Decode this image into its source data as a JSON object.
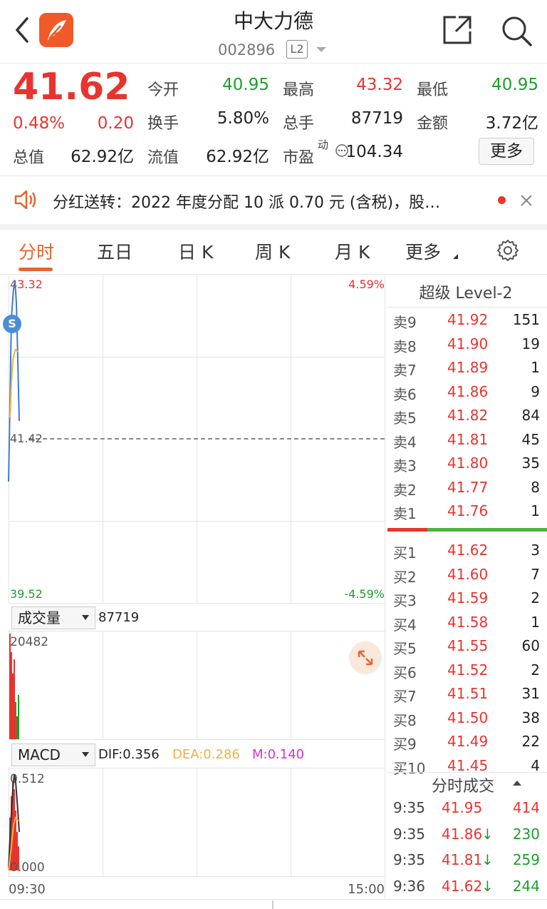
{
  "header": {
    "title": "中大力德",
    "code": "002896",
    "level_badge": "L2"
  },
  "quote": {
    "price": "41.62",
    "change_pct": "0.48%",
    "change": "0.20",
    "fields": [
      {
        "label": "今开",
        "value": "40.95",
        "color": "green"
      },
      {
        "label": "最高",
        "value": "43.32",
        "color": "red"
      },
      {
        "label": "最低",
        "value": "40.95",
        "color": "green"
      },
      {
        "label": "换手",
        "value": "5.80%",
        "color": "black"
      },
      {
        "label": "总手",
        "value": "87719",
        "color": "black"
      },
      {
        "label": "金额",
        "value": "3.72亿",
        "color": "black"
      },
      {
        "label": "总值",
        "value": "62.92亿",
        "color": "black"
      },
      {
        "label": "流值",
        "value": "62.92亿",
        "color": "black"
      },
      {
        "label": "市盈",
        "value": "104.34",
        "color": "black"
      }
    ],
    "pe_superscript": "动",
    "more_label": "更多"
  },
  "notice": {
    "text": "分红送转：2022 年度分配 10 派 0.70 元 (含税)，股…"
  },
  "tabs": [
    "分时",
    "五日",
    "日 K",
    "周 K",
    "月 K",
    "更多"
  ],
  "chart": {
    "high_price": "43.32",
    "high_pct": "4.59%",
    "mid_price": "41.42",
    "low_price": "39.52",
    "low_pct": "-4.59%",
    "volume_selector": "成交量",
    "volume_total": "87719",
    "volume_max": "20482",
    "macd_selector": "MACD",
    "dif": "DIF:0.356",
    "dea": "DEA:0.286",
    "m": "M:0.140",
    "macd_top": "0.512",
    "macd_bottom": "0.000",
    "time_start": "09:30",
    "time_end": "15:00",
    "marker": "S"
  },
  "order_book": {
    "title": "超级 Level-2",
    "asks": [
      {
        "label": "卖9",
        "price": "41.92",
        "vol": "151"
      },
      {
        "label": "卖8",
        "price": "41.90",
        "vol": "19"
      },
      {
        "label": "卖7",
        "price": "41.89",
        "vol": "1"
      },
      {
        "label": "卖6",
        "price": "41.86",
        "vol": "9"
      },
      {
        "label": "卖5",
        "price": "41.82",
        "vol": "84"
      },
      {
        "label": "卖4",
        "price": "41.81",
        "vol": "45"
      },
      {
        "label": "卖3",
        "price": "41.80",
        "vol": "35"
      },
      {
        "label": "卖2",
        "price": "41.77",
        "vol": "8"
      },
      {
        "label": "卖1",
        "price": "41.76",
        "vol": "1"
      }
    ],
    "bids": [
      {
        "label": "买1",
        "price": "41.62",
        "vol": "3"
      },
      {
        "label": "买2",
        "price": "41.60",
        "vol": "7"
      },
      {
        "label": "买3",
        "price": "41.59",
        "vol": "2"
      },
      {
        "label": "买4",
        "price": "41.58",
        "vol": "1"
      },
      {
        "label": "买5",
        "price": "41.55",
        "vol": "60"
      },
      {
        "label": "买6",
        "price": "41.52",
        "vol": "2"
      },
      {
        "label": "买7",
        "price": "41.51",
        "vol": "31"
      },
      {
        "label": "买8",
        "price": "41.50",
        "vol": "38"
      },
      {
        "label": "买9",
        "price": "41.49",
        "vol": "22"
      },
      {
        "label": "买10",
        "price": "41.45",
        "vol": "4"
      }
    ]
  },
  "trades": {
    "title": "分时成交",
    "rows": [
      {
        "time": "9:35",
        "price": "41.95",
        "arrow": "",
        "vol": "414",
        "vol_color": "red"
      },
      {
        "time": "9:35",
        "price": "41.86",
        "arrow": "↓",
        "vol": "230",
        "vol_color": "green"
      },
      {
        "time": "9:35",
        "price": "41.81",
        "arrow": "↓",
        "vol": "259",
        "vol_color": "green"
      },
      {
        "time": "9:36",
        "price": "41.62",
        "arrow": "↓",
        "vol": "244",
        "vol_color": "green"
      }
    ]
  },
  "colors": {
    "up": "#e8342f",
    "down": "#1c9e2c",
    "accent": "#e8642f",
    "price_line": "#3a7bd5",
    "avg_line": "#f0b23c",
    "dea": "#f0b23c",
    "m": "#d62fd0"
  }
}
